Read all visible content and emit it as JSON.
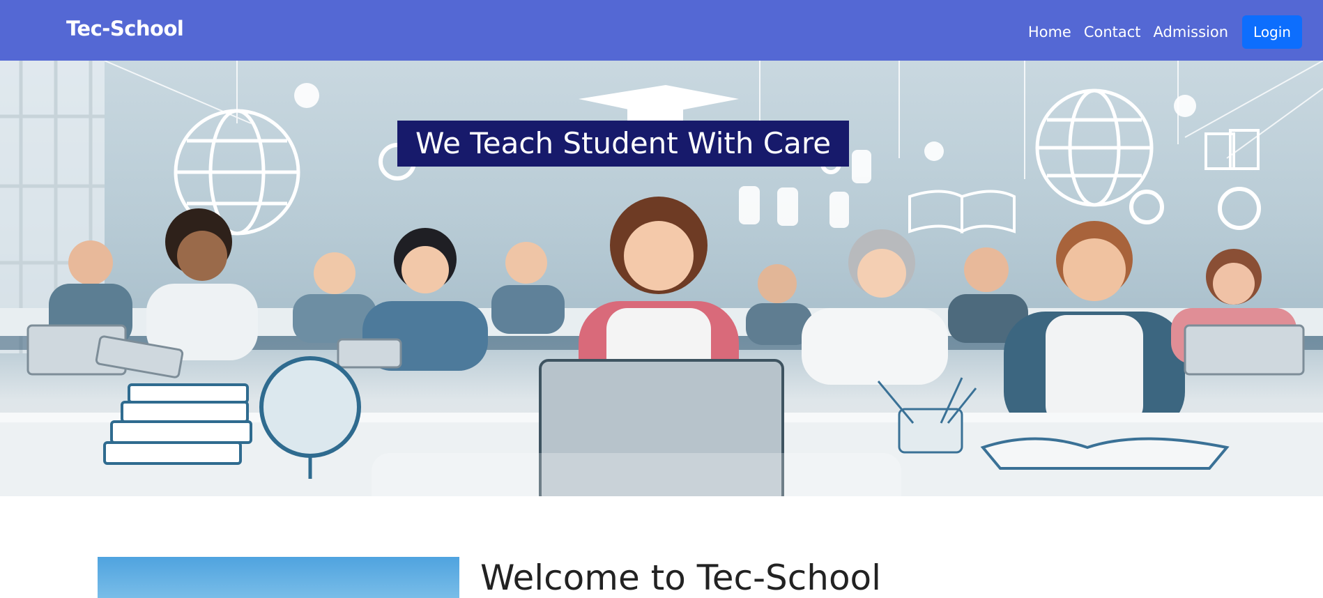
{
  "navbar": {
    "brand": "Tec-School",
    "links": [
      "Home",
      "Contact",
      "Admission"
    ],
    "login_label": "Login"
  },
  "hero": {
    "title": "We Teach Student With Care",
    "image_description_icon": "classroom-illustration"
  },
  "welcome": {
    "title": "Welcome to Tec-School"
  },
  "colors": {
    "navbar": "#5468d4",
    "login": "#0d6efd",
    "hero_title_bg": "#171a6b"
  }
}
